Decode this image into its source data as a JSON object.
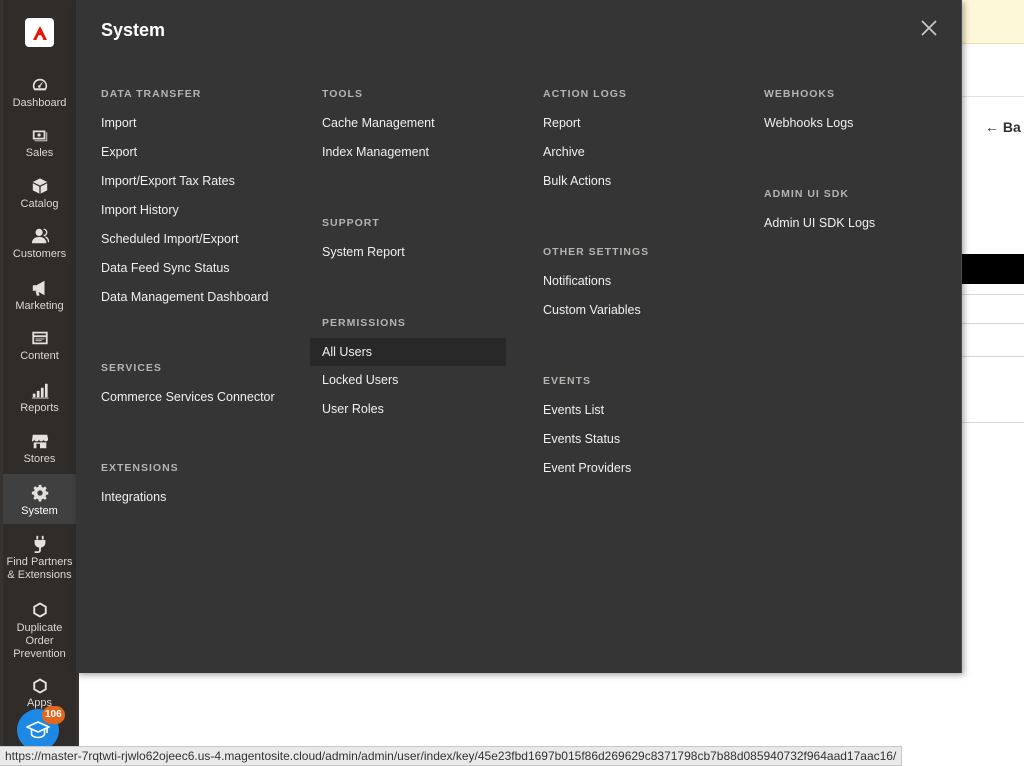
{
  "nav": {
    "items": [
      {
        "label": "Dashboard",
        "icon": "dashboard-icon"
      },
      {
        "label": "Sales",
        "icon": "sales-icon"
      },
      {
        "label": "Catalog",
        "icon": "catalog-icon"
      },
      {
        "label": "Customers",
        "icon": "customers-icon"
      },
      {
        "label": "Marketing",
        "icon": "marketing-icon"
      },
      {
        "label": "Content",
        "icon": "content-icon"
      },
      {
        "label": "Reports",
        "icon": "reports-icon"
      },
      {
        "label": "Stores",
        "icon": "stores-icon"
      },
      {
        "label": "System",
        "icon": "gear-icon"
      },
      {
        "label": "Find Partners & Extensions",
        "icon": "plug-icon"
      },
      {
        "label": "Duplicate Order Prevention",
        "icon": "hexagon-icon"
      },
      {
        "label": "Apps",
        "icon": "hexagon-icon"
      }
    ],
    "active": "System"
  },
  "panel": {
    "title": "System",
    "groups": {
      "data_transfer": {
        "title": "Data Transfer",
        "items": [
          "Import",
          "Export",
          "Import/Export Tax Rates",
          "Import History",
          "Scheduled Import/Export",
          "Data Feed Sync Status",
          "Data Management Dashboard"
        ]
      },
      "services": {
        "title": "Services",
        "items": [
          "Commerce Services Connector"
        ]
      },
      "extensions": {
        "title": "Extensions",
        "items": [
          "Integrations"
        ]
      },
      "tools": {
        "title": "Tools",
        "items": [
          "Cache Management",
          "Index Management"
        ]
      },
      "support": {
        "title": "Support",
        "items": [
          "System Report"
        ]
      },
      "permissions": {
        "title": "Permissions",
        "items": [
          "All Users",
          "Locked Users",
          "User Roles"
        ]
      },
      "action_logs": {
        "title": "Action Logs",
        "items": [
          "Report",
          "Archive",
          "Bulk Actions"
        ]
      },
      "other_settings": {
        "title": "Other Settings",
        "items": [
          "Notifications",
          "Custom Variables"
        ]
      },
      "events": {
        "title": "Events",
        "items": [
          "Events List",
          "Events Status",
          "Event Providers"
        ]
      },
      "webhooks": {
        "title": "Webhooks",
        "items": [
          "Webhooks Logs"
        ]
      },
      "admin_ui_sdk": {
        "title": "Admin UI SDK",
        "items": [
          "Admin UI SDK Logs"
        ]
      }
    }
  },
  "background": {
    "back_label": "Ba"
  },
  "help": {
    "badge_count": "106"
  },
  "status_bar": {
    "url": "https://master-7rqtwti-rjwlo62ojeec6.us-4.magentosite.cloud/admin/admin/user/index/key/45e23fbd1697b015f86d269629c8371798cb7b88d085940732f964aad17aac16/"
  },
  "colors": {
    "panel_bg": "#353535",
    "nav_bg": "#2f2c29",
    "logo_red": "#eb1000",
    "help_blue": "#1e88e5",
    "badge_orange": "#e3661f"
  }
}
